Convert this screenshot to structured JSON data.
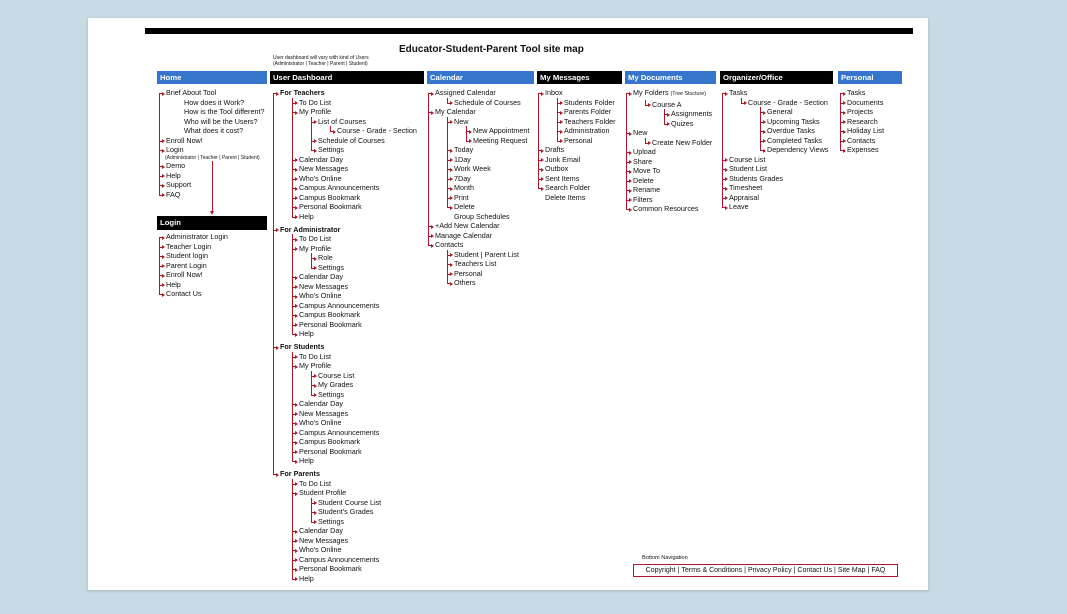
{
  "title": "Educator-Student-Parent Tool site map",
  "dashboard_note": {
    "line1": "User dashboard will vary with kind of Users",
    "line2": "(Administrator | Teacher | Parent | Student)"
  },
  "colors": {
    "page_background": "#c7dbe4",
    "header_blue": "#3575cc",
    "header_black": "#000000",
    "connector_red": "#b0162a"
  },
  "columns": [
    {
      "title": "Home",
      "header_color": "#3575cc",
      "items": [
        {
          "label": "Brief About Tool",
          "children_connected": false,
          "children": [
            {
              "label": "How does it Work?"
            },
            {
              "label": "How is the Tool different?"
            },
            {
              "label": "Who will be the Users?"
            },
            {
              "label": "What does it cost?"
            }
          ]
        },
        {
          "label": "Enroll Now!"
        },
        {
          "label": "Login",
          "note": "(Administrator | Teacher | Parent | Student)"
        },
        {
          "label": "Demo"
        },
        {
          "label": "Help"
        },
        {
          "label": "Support"
        },
        {
          "label": "FAQ"
        }
      ]
    },
    {
      "title": "User Dashboard",
      "header_color": "#000000",
      "items": [
        {
          "label": "For Teachers",
          "is_section": true,
          "children": [
            {
              "label": "To Do List"
            },
            {
              "label": "My Profile",
              "children": [
                {
                  "label": "List of Courses",
                  "children": [
                    {
                      "label": "Course - Grade - Section"
                    }
                  ]
                },
                {
                  "label": "Schedule of Courses"
                },
                {
                  "label": "Settings"
                }
              ]
            },
            {
              "label": "Calendar Day"
            },
            {
              "label": "New Messages"
            },
            {
              "label": "Who's Online"
            },
            {
              "label": "Campus Announcements"
            },
            {
              "label": "Campus Bookmark"
            },
            {
              "label": "Personal Bookmark"
            },
            {
              "label": "Help"
            }
          ]
        },
        {
          "label": "For Administrator",
          "is_section": true,
          "children": [
            {
              "label": "To Do List"
            },
            {
              "label": "My Profile",
              "children": [
                {
                  "label": "Role"
                },
                {
                  "label": "Settings"
                }
              ]
            },
            {
              "label": "Calendar Day"
            },
            {
              "label": "New Messages"
            },
            {
              "label": "Who's Online"
            },
            {
              "label": "Campus Announcements"
            },
            {
              "label": "Campus Bookmark"
            },
            {
              "label": "Personal Bookmark"
            },
            {
              "label": "Help"
            }
          ]
        },
        {
          "label": "For Students",
          "is_section": true,
          "children": [
            {
              "label": "To Do List"
            },
            {
              "label": "My Profile",
              "children": [
                {
                  "label": "Course List"
                },
                {
                  "label": "My Grades"
                },
                {
                  "label": "Settings"
                }
              ]
            },
            {
              "label": "Calendar Day"
            },
            {
              "label": "New Messages"
            },
            {
              "label": "Who's Online"
            },
            {
              "label": "Campus Announcements"
            },
            {
              "label": "Campus Bookmark"
            },
            {
              "label": "Personal Bookmark"
            },
            {
              "label": "Help"
            }
          ]
        },
        {
          "label": "For Parents",
          "is_section": true,
          "children": [
            {
              "label": "To Do List"
            },
            {
              "label": "Student Profile",
              "children": [
                {
                  "label": "Student Course List"
                },
                {
                  "label": "Student's Grades"
                },
                {
                  "label": "Settings"
                }
              ]
            },
            {
              "label": "Calendar Day"
            },
            {
              "label": "New Messages"
            },
            {
              "label": "Who's Online"
            },
            {
              "label": "Campus Announcements"
            },
            {
              "label": "Personal Bookmark"
            },
            {
              "label": "Help"
            }
          ]
        }
      ]
    },
    {
      "title": "Calendar",
      "header_color": "#3575cc",
      "items": [
        {
          "label": "Assigned Calendar",
          "children": [
            {
              "label": "Schedule of Courses"
            }
          ]
        },
        {
          "label": "My Calendar",
          "children": [
            {
              "label": "New",
              "children": [
                {
                  "label": "New Appointment"
                },
                {
                  "label": "Meeting Request"
                }
              ]
            },
            {
              "label": "Today"
            },
            {
              "label": "1Day"
            },
            {
              "label": "Work Week"
            },
            {
              "label": "7Day"
            },
            {
              "label": "Month"
            },
            {
              "label": "Print"
            },
            {
              "label": "Delete"
            },
            {
              "label": "Group Schedules",
              "has_arrow": false
            }
          ]
        },
        {
          "label": "+Add New Calendar"
        },
        {
          "label": "Manage Calendar"
        },
        {
          "label": "Contacts",
          "children": [
            {
              "label": "Student | Parent List"
            },
            {
              "label": "Teachers List"
            },
            {
              "label": "Personal"
            },
            {
              "label": "Others"
            }
          ]
        }
      ]
    },
    {
      "title": "My Messages",
      "header_color": "#000000",
      "items": [
        {
          "label": "Inbox",
          "children": [
            {
              "label": "Students Folder"
            },
            {
              "label": "Parents Folder"
            },
            {
              "label": "Teachers Folder"
            },
            {
              "label": "Administration"
            },
            {
              "label": "Personal"
            }
          ]
        },
        {
          "label": "Drafts"
        },
        {
          "label": "Junk Email"
        },
        {
          "label": "Outbox"
        },
        {
          "label": "Sent Items"
        },
        {
          "label": "Search Folder"
        },
        {
          "label": "Delete Items",
          "has_arrow": false
        }
      ]
    },
    {
      "title": "My Documents",
      "header_color": "#3575cc",
      "items": [
        {
          "label": "My Folders ",
          "suffix": "(Tree Stucture)",
          "children": [
            {
              "label": "Course A",
              "children": [
                {
                  "label": "Assignments"
                },
                {
                  "label": "Quizes"
                }
              ]
            }
          ]
        },
        {
          "label": "New",
          "children": [
            {
              "label": "Create New Folder"
            }
          ]
        },
        {
          "label": "Upload"
        },
        {
          "label": "Share"
        },
        {
          "label": "Move To"
        },
        {
          "label": "Delete"
        },
        {
          "label": "Rename"
        },
        {
          "label": "Filters"
        },
        {
          "label": "Common Resources"
        }
      ]
    },
    {
      "title": "Organizer/Office",
      "header_color": "#000000",
      "items": [
        {
          "label": "Tasks",
          "children": [
            {
              "label": "Course - Grade - Section",
              "children": [
                {
                  "label": "General"
                },
                {
                  "label": "Upcoming Tasks"
                },
                {
                  "label": "Overdue Tasks"
                },
                {
                  "label": "Completed Tasks"
                },
                {
                  "label": "Dependency Views"
                }
              ]
            }
          ]
        },
        {
          "label": "Course List"
        },
        {
          "label": "Student List"
        },
        {
          "label": "Students Grades"
        },
        {
          "label": "Timesheet"
        },
        {
          "label": "Appraisal"
        },
        {
          "label": "Leave"
        }
      ]
    },
    {
      "title": "Personal",
      "header_color": "#3575cc",
      "items": [
        {
          "label": "Tasks"
        },
        {
          "label": "Documents"
        },
        {
          "label": "Projects"
        },
        {
          "label": "Research"
        },
        {
          "label": "Holiday List"
        },
        {
          "label": "Contacts"
        },
        {
          "label": "Expenses"
        }
      ]
    }
  ],
  "login_box": {
    "title": "Login",
    "header_color": "#000000",
    "items": [
      {
        "label": "Administrator Login"
      },
      {
        "label": "Teacher Login"
      },
      {
        "label": "Student login"
      },
      {
        "label": "Parent Login"
      },
      {
        "label": "Enroll Now!"
      },
      {
        "label": "Help"
      },
      {
        "label": "Contact Us"
      }
    ]
  },
  "footer": {
    "caption": "Bottom Navigation",
    "separator": "|",
    "links": [
      "Copyright",
      "Terms & Conditions",
      "Privacy Policy",
      "Contact Us",
      "Site Map",
      "FAQ"
    ]
  }
}
